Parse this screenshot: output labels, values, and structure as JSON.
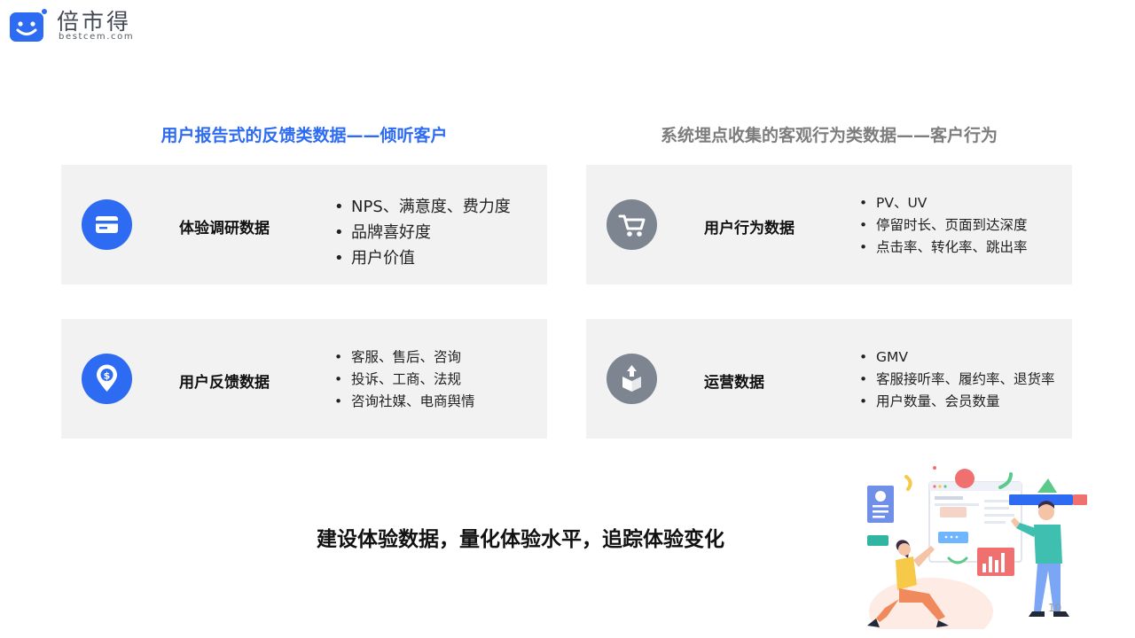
{
  "logo": {
    "name": "倍市得",
    "domain": "bestcem.com"
  },
  "sections": {
    "left_heading": "用户报告式的反馈类数据——倾听客户",
    "right_heading": "系统埋点收集的客观行为类数据——客户行为"
  },
  "cards": [
    {
      "title": "体验调研数据",
      "icon": "credit-card-icon",
      "items": [
        "NPS、满意度、费力度",
        "品牌喜好度",
        "用户价值"
      ]
    },
    {
      "title": "用户行为数据",
      "icon": "shopping-cart-icon",
      "items": [
        "PV、UV",
        "停留时长、页面到达深度",
        "点击率、转化率、跳出率"
      ]
    },
    {
      "title": "用户反馈数据",
      "icon": "location-pin-dollar-icon",
      "items": [
        "客服、售后、咨询",
        "投诉、工商、法规",
        "咨询社媒、电商舆情"
      ]
    },
    {
      "title": "运营数据",
      "icon": "package-box-icon",
      "items": [
        "GMV",
        "客服接听率、履约率、退货率",
        "用户数量、会员数量"
      ]
    }
  ],
  "tagline": "建设体验数据，量化体验水平，追踪体验变化",
  "page_number": "10",
  "colors": {
    "accent_blue": "#2d6bf2",
    "heading_gray": "#7d7d7d",
    "icon_gray": "#7d8591",
    "card_bg": "#f2f2f2"
  }
}
